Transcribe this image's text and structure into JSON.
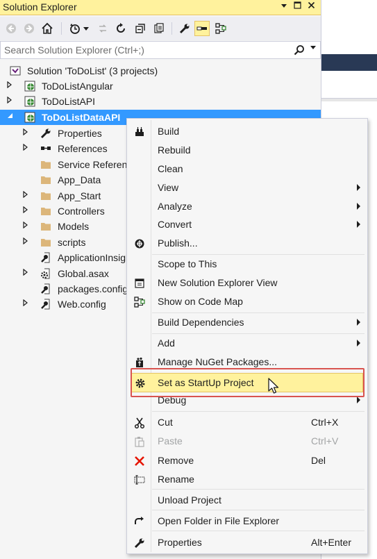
{
  "window": {
    "title": "Solution Explorer"
  },
  "search": {
    "placeholder": "Search Solution Explorer (Ctrl+;)"
  },
  "colors": {
    "title_bar": "#fff29d",
    "selection": "#3399ff",
    "highlight_box": "#d9534f",
    "menu_hover": "#fff29d"
  },
  "toolbar": {
    "buttons": [
      "back-icon",
      "forward-icon",
      "home-icon",
      "history-icon",
      "sync-icon",
      "refresh-icon",
      "collapse-all-icon",
      "show-all-files-icon",
      "properties-wrench-icon",
      "preview-selected-icon",
      "class-view-icon"
    ]
  },
  "tree": {
    "solution": "Solution 'ToDoList' (3 projects)",
    "items": [
      {
        "label": "ToDoListAngular",
        "icon": "globe-project-icon"
      },
      {
        "label": "ToDoListAPI",
        "icon": "globe-project-icon"
      },
      {
        "label": "ToDoListDataAPI",
        "icon": "globe-project-icon",
        "selected": true
      },
      {
        "label": "Properties",
        "icon": "wrench-icon"
      },
      {
        "label": "References",
        "icon": "references-icon"
      },
      {
        "label": "Service References",
        "icon": "folder-icon"
      },
      {
        "label": "App_Data",
        "icon": "folder-icon"
      },
      {
        "label": "App_Start",
        "icon": "folder-icon"
      },
      {
        "label": "Controllers",
        "icon": "folder-icon"
      },
      {
        "label": "Models",
        "icon": "folder-icon"
      },
      {
        "label": "scripts",
        "icon": "folder-icon"
      },
      {
        "label": "ApplicationInsights.config",
        "icon": "config-icon"
      },
      {
        "label": "Global.asax",
        "icon": "global-asax-icon"
      },
      {
        "label": "packages.config",
        "icon": "config-icon"
      },
      {
        "label": "Web.config",
        "icon": "config-icon"
      }
    ]
  },
  "menu": {
    "items": [
      {
        "label": "Build",
        "icon": "build-icon"
      },
      {
        "label": "Rebuild"
      },
      {
        "label": "Clean"
      },
      {
        "label": "View",
        "submenu": true
      },
      {
        "label": "Analyze",
        "submenu": true
      },
      {
        "label": "Convert",
        "submenu": true
      },
      {
        "label": "Publish...",
        "icon": "publish-icon"
      },
      {
        "label": "Scope to This"
      },
      {
        "label": "New Solution Explorer View",
        "icon": "new-view-icon"
      },
      {
        "label": "Show on Code Map",
        "icon": "code-map-icon"
      },
      {
        "label": "Build Dependencies",
        "submenu": true
      },
      {
        "label": "Add",
        "submenu": true
      },
      {
        "label": "Manage NuGet Packages...",
        "icon": "nuget-icon"
      },
      {
        "label": "Set as StartUp Project",
        "icon": "gear-icon",
        "hover": true
      },
      {
        "label": "Debug",
        "submenu": true
      },
      {
        "label": "Cut",
        "shortcut": "Ctrl+X",
        "icon": "scissors-icon"
      },
      {
        "label": "Paste",
        "shortcut": "Ctrl+V",
        "icon": "paste-icon",
        "disabled": true
      },
      {
        "label": "Remove",
        "shortcut": "Del",
        "icon": "remove-x-icon"
      },
      {
        "label": "Rename",
        "icon": "rename-icon"
      },
      {
        "label": "Unload Project"
      },
      {
        "label": "Open Folder in File Explorer",
        "icon": "open-folder-arrow-icon"
      },
      {
        "label": "Properties",
        "shortcut": "Alt+Enter",
        "icon": "wrench-icon"
      }
    ]
  }
}
